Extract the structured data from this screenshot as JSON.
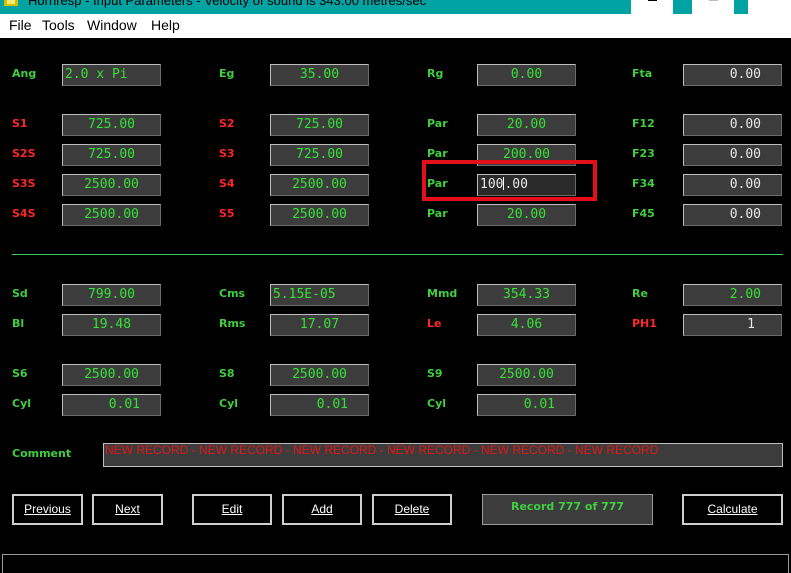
{
  "window": {
    "title": "Hornresp - Input Parameters - Velocity of sound is 343.00 metres/sec"
  },
  "menu": [
    "File",
    "Tools",
    "Window",
    "Help"
  ],
  "params": {
    "ang": {
      "label": "Ang",
      "value": "2.0 x Pi"
    },
    "eg": {
      "label": "Eg",
      "value": "35.00"
    },
    "rg": {
      "label": "Rg",
      "value": "0.00"
    },
    "fta": {
      "label": "Fta",
      "value": "0.00"
    },
    "s1": {
      "label": "S1",
      "value": "725.00"
    },
    "s2": {
      "label": "S2",
      "value": "725.00"
    },
    "par1": {
      "label": "Par",
      "value": "20.00"
    },
    "f12": {
      "label": "F12",
      "value": "0.00"
    },
    "s2b": {
      "label": "S2S",
      "value": "725.00"
    },
    "s3": {
      "label": "S3",
      "value": "725.00"
    },
    "par2": {
      "label": "Par",
      "value": "200.00"
    },
    "f23": {
      "label": "F23",
      "value": "0.00"
    },
    "s3b": {
      "label": "S3S",
      "value": "2500.00"
    },
    "s4": {
      "label": "S4",
      "value": "2500.00"
    },
    "par3": {
      "label": "Par",
      "value_before_caret": "100",
      "value_after_caret": ".00"
    },
    "f34": {
      "label": "F34",
      "value": "0.00"
    },
    "s4b": {
      "label": "S4S",
      "value": "2500.00"
    },
    "s5": {
      "label": "S5",
      "value": "2500.00"
    },
    "par4": {
      "label": "Par",
      "value": "20.00"
    },
    "f45": {
      "label": "F45",
      "value": "0.00"
    },
    "sd": {
      "label": "Sd",
      "value": "799.00"
    },
    "cms": {
      "label": "Cms",
      "value": "5.15E-05"
    },
    "mmd": {
      "label": "Mmd",
      "value": "354.33"
    },
    "re": {
      "label": "Re",
      "value": "2.00"
    },
    "bl": {
      "label": "Bl",
      "value": "19.48"
    },
    "rms": {
      "label": "Rms",
      "value": "17.07"
    },
    "le": {
      "label": "Le",
      "value": "4.06"
    },
    "ph1": {
      "label": "PH1",
      "value": "1"
    },
    "s6": {
      "label": "S6",
      "value": "2500.00"
    },
    "s8": {
      "label": "S8",
      "value": "2500.00"
    },
    "s9": {
      "label": "S9",
      "value": "2500.00"
    },
    "cyl1": {
      "label": "Cyl",
      "value": "0.01"
    },
    "cyl2": {
      "label": "Cyl",
      "value": "0.01"
    },
    "cyl3": {
      "label": "Cyl",
      "value": "0.01"
    }
  },
  "comment": {
    "label": "Comment",
    "value": "NEW RECORD - NEW RECORD - NEW RECORD - NEW RECORD - NEW RECORD - NEW RECORD"
  },
  "buttons": {
    "previous": "Previous",
    "next": "Next",
    "edit": "Edit",
    "add": "Add",
    "delete": "Delete",
    "calculate": "Calculate"
  },
  "record": "Record 777 of 777",
  "colors": {
    "label_green": "#3fcf3f",
    "label_red": "#ff2626",
    "field_bg": "#3c3c3c",
    "highlight": "#e3101c",
    "titlebar": "#00a2a2"
  }
}
